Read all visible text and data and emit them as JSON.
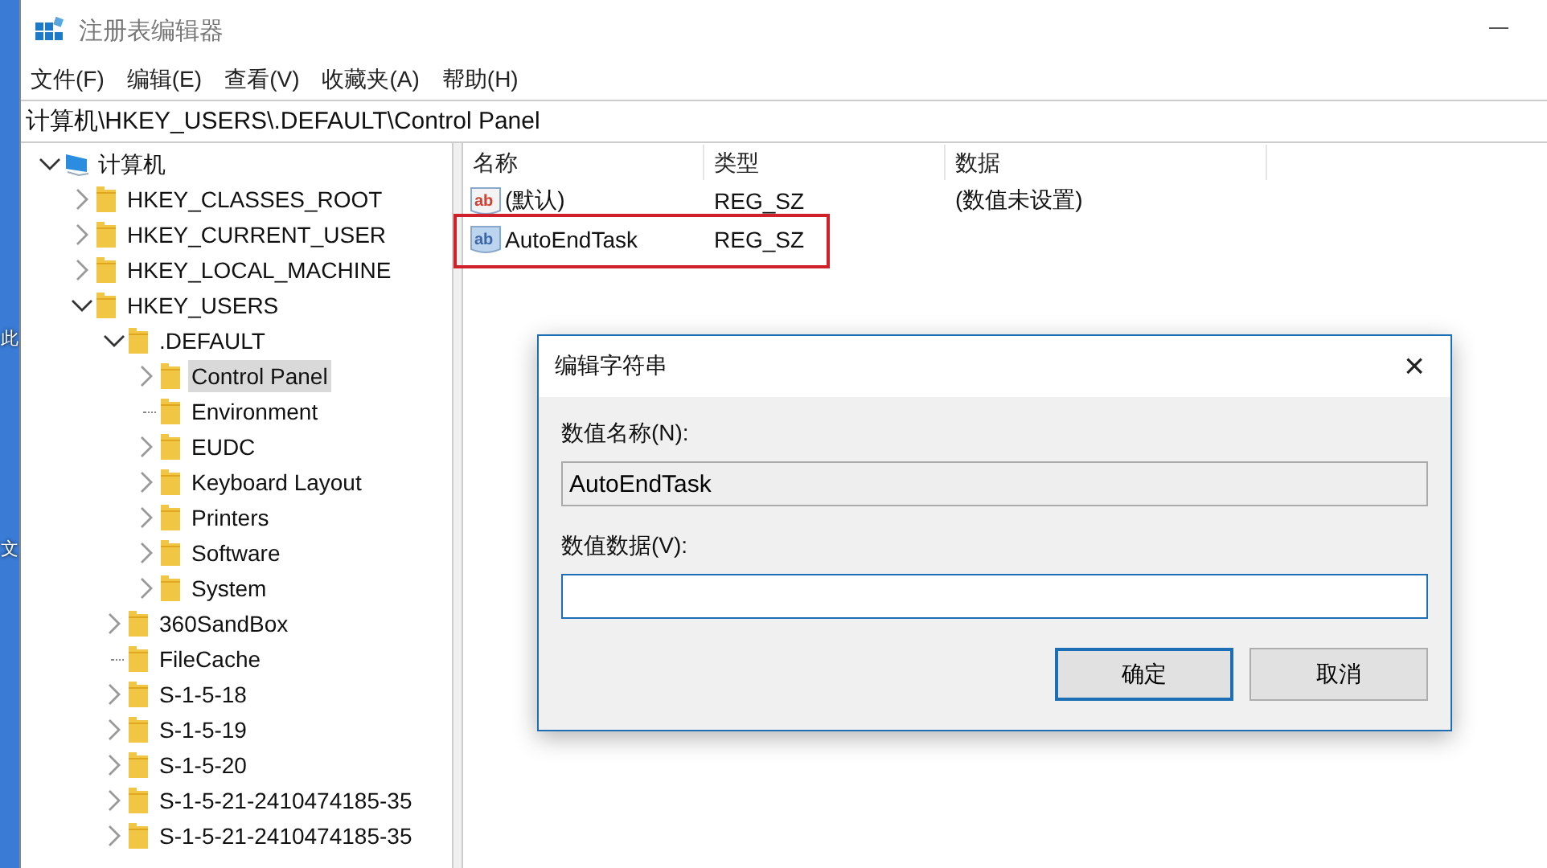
{
  "desktop": {
    "labels": [
      "此",
      "文"
    ]
  },
  "window": {
    "title": "注册表编辑器"
  },
  "menu": [
    "文件(F)",
    "编辑(E)",
    "查看(V)",
    "收藏夹(A)",
    "帮助(H)"
  ],
  "address": "计算机\\HKEY_USERS\\.DEFAULT\\Control Panel",
  "tree": [
    {
      "label": "计算机",
      "kind": "computer",
      "expanded": true,
      "selected": false,
      "children": [
        {
          "label": "HKEY_CLASSES_ROOT",
          "kind": "branch",
          "expanded": false,
          "selected": false
        },
        {
          "label": "HKEY_CURRENT_USER",
          "kind": "branch",
          "expanded": false,
          "selected": false
        },
        {
          "label": "HKEY_LOCAL_MACHINE",
          "kind": "branch",
          "expanded": false,
          "selected": false
        },
        {
          "label": "HKEY_USERS",
          "kind": "branch",
          "expanded": true,
          "selected": false,
          "children": [
            {
              "label": ".DEFAULT",
              "kind": "branch",
              "expanded": true,
              "selected": false,
              "children": [
                {
                  "label": "Control Panel",
                  "kind": "branch",
                  "expanded": false,
                  "selected": true
                },
                {
                  "label": "Environment",
                  "kind": "leaf",
                  "selected": false
                },
                {
                  "label": "EUDC",
                  "kind": "branch",
                  "expanded": false,
                  "selected": false
                },
                {
                  "label": "Keyboard Layout",
                  "kind": "branch",
                  "expanded": false,
                  "selected": false
                },
                {
                  "label": "Printers",
                  "kind": "branch",
                  "expanded": false,
                  "selected": false
                },
                {
                  "label": "Software",
                  "kind": "branch",
                  "expanded": false,
                  "selected": false
                },
                {
                  "label": "System",
                  "kind": "branch",
                  "expanded": false,
                  "selected": false
                }
              ]
            },
            {
              "label": "360SandBox",
              "kind": "branch",
              "expanded": false,
              "selected": false
            },
            {
              "label": "FileCache",
              "kind": "leaf",
              "selected": false
            },
            {
              "label": "S-1-5-18",
              "kind": "branch",
              "expanded": false,
              "selected": false
            },
            {
              "label": "S-1-5-19",
              "kind": "branch",
              "expanded": false,
              "selected": false
            },
            {
              "label": "S-1-5-20",
              "kind": "branch",
              "expanded": false,
              "selected": false
            },
            {
              "label": "S-1-5-21-2410474185-35",
              "kind": "branch",
              "expanded": false,
              "selected": false
            },
            {
              "label": "S-1-5-21-2410474185-35",
              "kind": "branch",
              "expanded": false,
              "selected": false
            }
          ]
        }
      ]
    }
  ],
  "values": {
    "columns": [
      "名称",
      "类型",
      "数据"
    ],
    "rows": [
      {
        "icon": "ab",
        "name": "(默认)",
        "type": "REG_SZ",
        "data": "(数值未设置)",
        "highlighted": false
      },
      {
        "icon": "ab",
        "name": "AutoEndTask",
        "type": "REG_SZ",
        "highlighted": true
      }
    ]
  },
  "dialog": {
    "title": "编辑字符串",
    "close": "×",
    "name_label": "数值名称(N):",
    "name_value": "AutoEndTask",
    "data_label": "数值数据(V):",
    "buttons": [
      {
        "label": "确定",
        "default": true
      },
      {
        "label": "取消",
        "default": false
      }
    ]
  }
}
